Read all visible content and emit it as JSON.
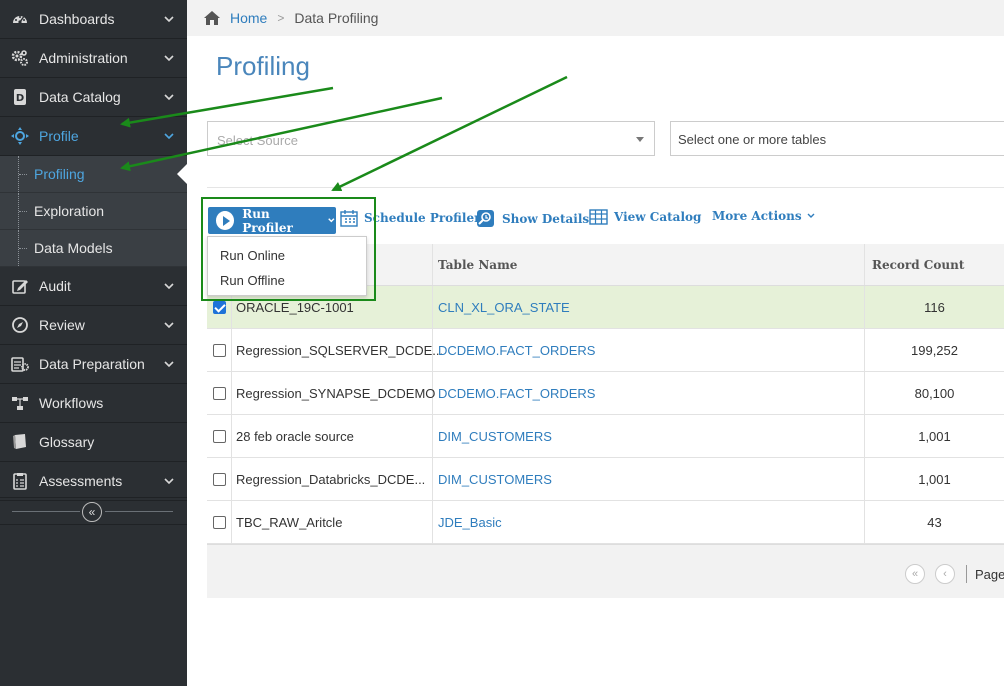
{
  "sidebar": {
    "items": [
      {
        "label": "Dashboards",
        "icon": "dashboard-icon",
        "has_chevron": true
      },
      {
        "label": "Administration",
        "icon": "gears-icon",
        "has_chevron": true
      },
      {
        "label": "Data Catalog",
        "icon": "catalog-icon",
        "has_chevron": true
      },
      {
        "label": "Profile",
        "icon": "profile-icon",
        "has_chevron": true,
        "active": true
      },
      {
        "label": "Audit",
        "icon": "audit-icon",
        "has_chevron": true
      },
      {
        "label": "Review",
        "icon": "review-icon",
        "has_chevron": true
      },
      {
        "label": "Data Preparation",
        "icon": "data-prep-icon",
        "has_chevron": true
      },
      {
        "label": "Workflows",
        "icon": "workflows-icon",
        "has_chevron": false
      },
      {
        "label": "Glossary",
        "icon": "glossary-icon",
        "has_chevron": false
      },
      {
        "label": "Assessments",
        "icon": "assessments-icon",
        "has_chevron": true
      }
    ],
    "sub_items": [
      {
        "label": "Profiling",
        "active": true
      },
      {
        "label": "Exploration"
      },
      {
        "label": "Data Models"
      }
    ],
    "collapse_icon": "«"
  },
  "breadcrumb": {
    "home": "Home",
    "separator": ">",
    "current": "Data Profiling"
  },
  "page_title": "Profiling",
  "filters": {
    "source_placeholder": "Select Source",
    "tables_placeholder": "Select one or more tables"
  },
  "toolbar": {
    "run_profiler": "Run Profiler",
    "schedule_profiler": "Schedule Profiler",
    "show_details": "Show Details",
    "view_catalog": "View Catalog",
    "more_actions": "More Actions"
  },
  "run_menu": [
    "Run Online",
    "Run Offline"
  ],
  "table": {
    "columns": [
      "",
      "Table Name",
      "Record Count"
    ],
    "rows": [
      {
        "source": "ORACLE_19C-1001",
        "table": "CLN_XL_ORA_STATE",
        "count": "116",
        "checked": true
      },
      {
        "source": "Regression_SQLSERVER_DCDE...",
        "table": "DCDEMO.FACT_ORDERS",
        "count": "199,252",
        "checked": false
      },
      {
        "source": "Regression_SYNAPSE_DCDEMO",
        "table": "DCDEMO.FACT_ORDERS",
        "count": "80,100",
        "checked": false
      },
      {
        "source": "28 feb oracle source",
        "table": "DIM_CUSTOMERS",
        "count": "1,001",
        "checked": false
      },
      {
        "source": "Regression_Databricks_DCDE...",
        "table": "DIM_CUSTOMERS",
        "count": "1,001",
        "checked": false
      },
      {
        "source": "TBC_RAW_Aritcle",
        "table": "JDE_Basic",
        "count": "43",
        "checked": false
      }
    ]
  },
  "pagination": {
    "first": "«",
    "prev": "‹",
    "label": "Page"
  },
  "colors": {
    "accent": "#2f7dbd",
    "sidebar_bg": "#2b2f33",
    "highlight": "#1a8a1a",
    "selected_row": "#e6f1d8"
  }
}
